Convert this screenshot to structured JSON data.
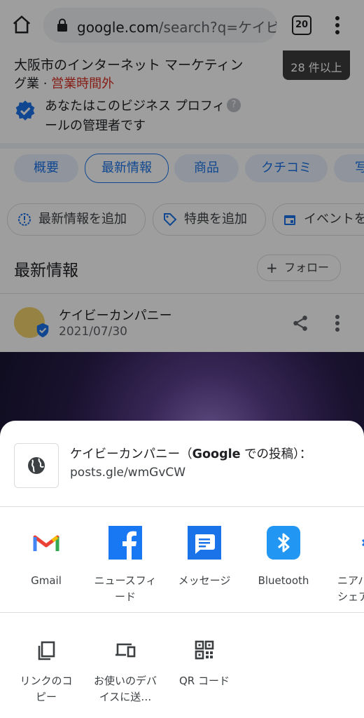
{
  "browser": {
    "url_domain": "google.com",
    "url_path": "/search?q=ケイビ",
    "tab_count": "20"
  },
  "page": {
    "business_line1": "大阪市のインターネット マーケティン",
    "business_line2_prefix": "グ業 · ",
    "business_status": "営業時間外",
    "photo_count": "28 件以上",
    "verified_text": "あなたはこのビジネス プロフィールの管理者です",
    "tabs": [
      "概要",
      "最新情報",
      "商品",
      "クチコミ",
      "写"
    ],
    "active_tab": "最新情報",
    "actions": [
      "最新情報を追加",
      "特典を追加",
      "イベントを"
    ],
    "news_title": "最新情報",
    "follow_label": "フォロー",
    "post_author": "ケイビーカンパニー",
    "post_date": "2021/07/30"
  },
  "share_sheet": {
    "title_prefix": "ケイビーカンパニー（",
    "title_bold": "Google",
    "title_suffix": " での投稿）：",
    "url": "posts.gle/wmGvCW",
    "apps": [
      {
        "label": "Gmail",
        "icon": "gmail-icon"
      },
      {
        "label": "ニュースフィード",
        "icon": "facebook-icon"
      },
      {
        "label": "メッセージ",
        "icon": "messages-icon"
      },
      {
        "label": "Bluetooth",
        "icon": "bluetooth-icon"
      },
      {
        "label": "ニアバイ シェア",
        "icon": "nearby-share-icon"
      }
    ],
    "tools": [
      {
        "label": "リンクのコピー",
        "icon": "copy-icon"
      },
      {
        "label": "お使いのデバイスに送…",
        "icon": "devices-icon"
      },
      {
        "label": "QR コード",
        "icon": "qr-code-icon"
      }
    ]
  },
  "colors": {
    "accent": "#1a73e8",
    "closed": "#d93025",
    "facebook": "#1877f2",
    "bluetooth": "#2196f3"
  }
}
